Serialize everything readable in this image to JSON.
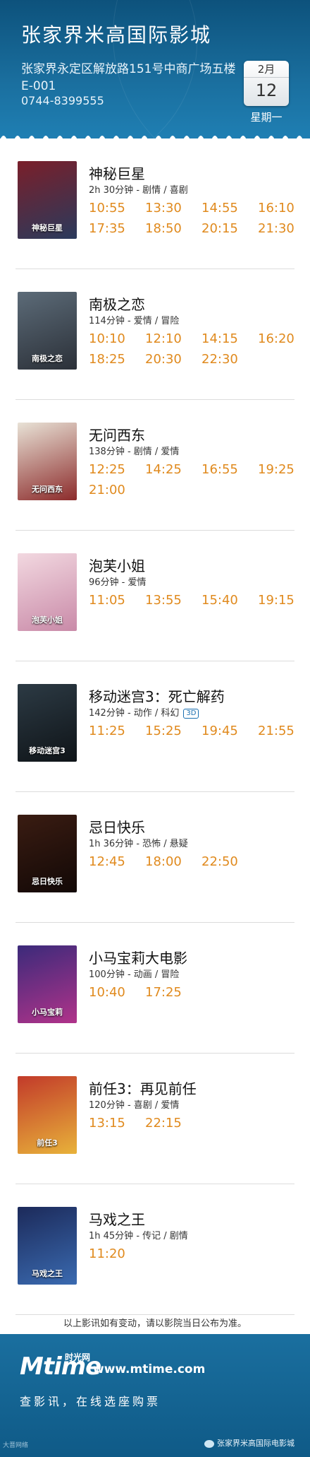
{
  "header": {
    "cinema_name": "张家界米高国际影城",
    "address": "张家界永定区解放路151号中商广场五楼E-001",
    "phone": "0744-8399555",
    "date": {
      "month": "2月",
      "day": "12",
      "weekday": "星期一"
    }
  },
  "movies": [
    {
      "title": "神秘巨星",
      "info": "2h 30分钟 - 剧情 / 喜剧",
      "is3d": false,
      "times": [
        "10:55",
        "13:30",
        "14:55",
        "16:10",
        "17:35",
        "18:50",
        "20:15",
        "21:30"
      ],
      "poster_colors": [
        "#7a1f2a",
        "#2a3a5c"
      ],
      "poster_text": "神秘巨星"
    },
    {
      "title": "南极之恋",
      "info": "114分钟 - 爱情 / 冒险",
      "is3d": false,
      "times": [
        "10:10",
        "12:10",
        "14:15",
        "16:20",
        "18:25",
        "20:30",
        "22:30"
      ],
      "poster_colors": [
        "#5c6b78",
        "#2b3038"
      ],
      "poster_text": "南极之恋"
    },
    {
      "title": "无问西东",
      "info": "138分钟 - 剧情 / 爱情",
      "is3d": false,
      "times": [
        "12:25",
        "14:25",
        "16:55",
        "19:25",
        "21:00"
      ],
      "poster_colors": [
        "#e8e2d6",
        "#8c2b2b"
      ],
      "poster_text": "无问西东"
    },
    {
      "title": "泡芙小姐",
      "info": "96分钟 - 爱情",
      "is3d": false,
      "times": [
        "11:05",
        "13:55",
        "15:40",
        "19:15"
      ],
      "poster_colors": [
        "#f2d8e0",
        "#c98aa8"
      ],
      "poster_text": "泡芙小姐"
    },
    {
      "title": "移动迷宫3：死亡解药",
      "info": "142分钟 - 动作 / 科幻",
      "is3d": true,
      "badge_3d": "3D",
      "times": [
        "11:25",
        "15:25",
        "19:45",
        "21:55"
      ],
      "poster_colors": [
        "#2c3a44",
        "#0f1418"
      ],
      "poster_text": "移动迷宫3"
    },
    {
      "title": "忌日快乐",
      "info": "1h 36分钟 - 恐怖 / 悬疑",
      "is3d": false,
      "times": [
        "12:45",
        "18:00",
        "22:50"
      ],
      "poster_colors": [
        "#3a1c12",
        "#120806"
      ],
      "poster_text": "忌日快乐"
    },
    {
      "title": "小马宝莉大电影",
      "info": "100分钟 - 动画 / 冒险",
      "is3d": false,
      "times": [
        "10:40",
        "17:25"
      ],
      "poster_colors": [
        "#3b2a7a",
        "#b0338a"
      ],
      "poster_text": "小马宝莉"
    },
    {
      "title": "前任3：再见前任",
      "info": "120分钟 - 喜剧 / 爱情",
      "is3d": false,
      "times": [
        "13:15",
        "22:15"
      ],
      "poster_colors": [
        "#c23a2a",
        "#e8b23a"
      ],
      "poster_text": "前任3"
    },
    {
      "title": "马戏之王",
      "info": "1h 45分钟 - 传记 / 剧情",
      "is3d": false,
      "times": [
        "11:20"
      ],
      "poster_colors": [
        "#1c2a5a",
        "#3a6ab0"
      ],
      "poster_text": "马戏之王"
    }
  ],
  "footnote": "以上影讯如有变动，请以影院当日公布为准。",
  "footer": {
    "logo_text": "Mtime",
    "logo_cn": "时光网",
    "url": "www.mtime.com",
    "slogan": "查影讯，在线选座购票",
    "wechat": "张家界米高国际电影城",
    "credit": "大晋网络"
  },
  "colors": {
    "header_blue": "#1a6f9f",
    "showtime_orange": "#e08a1e"
  }
}
